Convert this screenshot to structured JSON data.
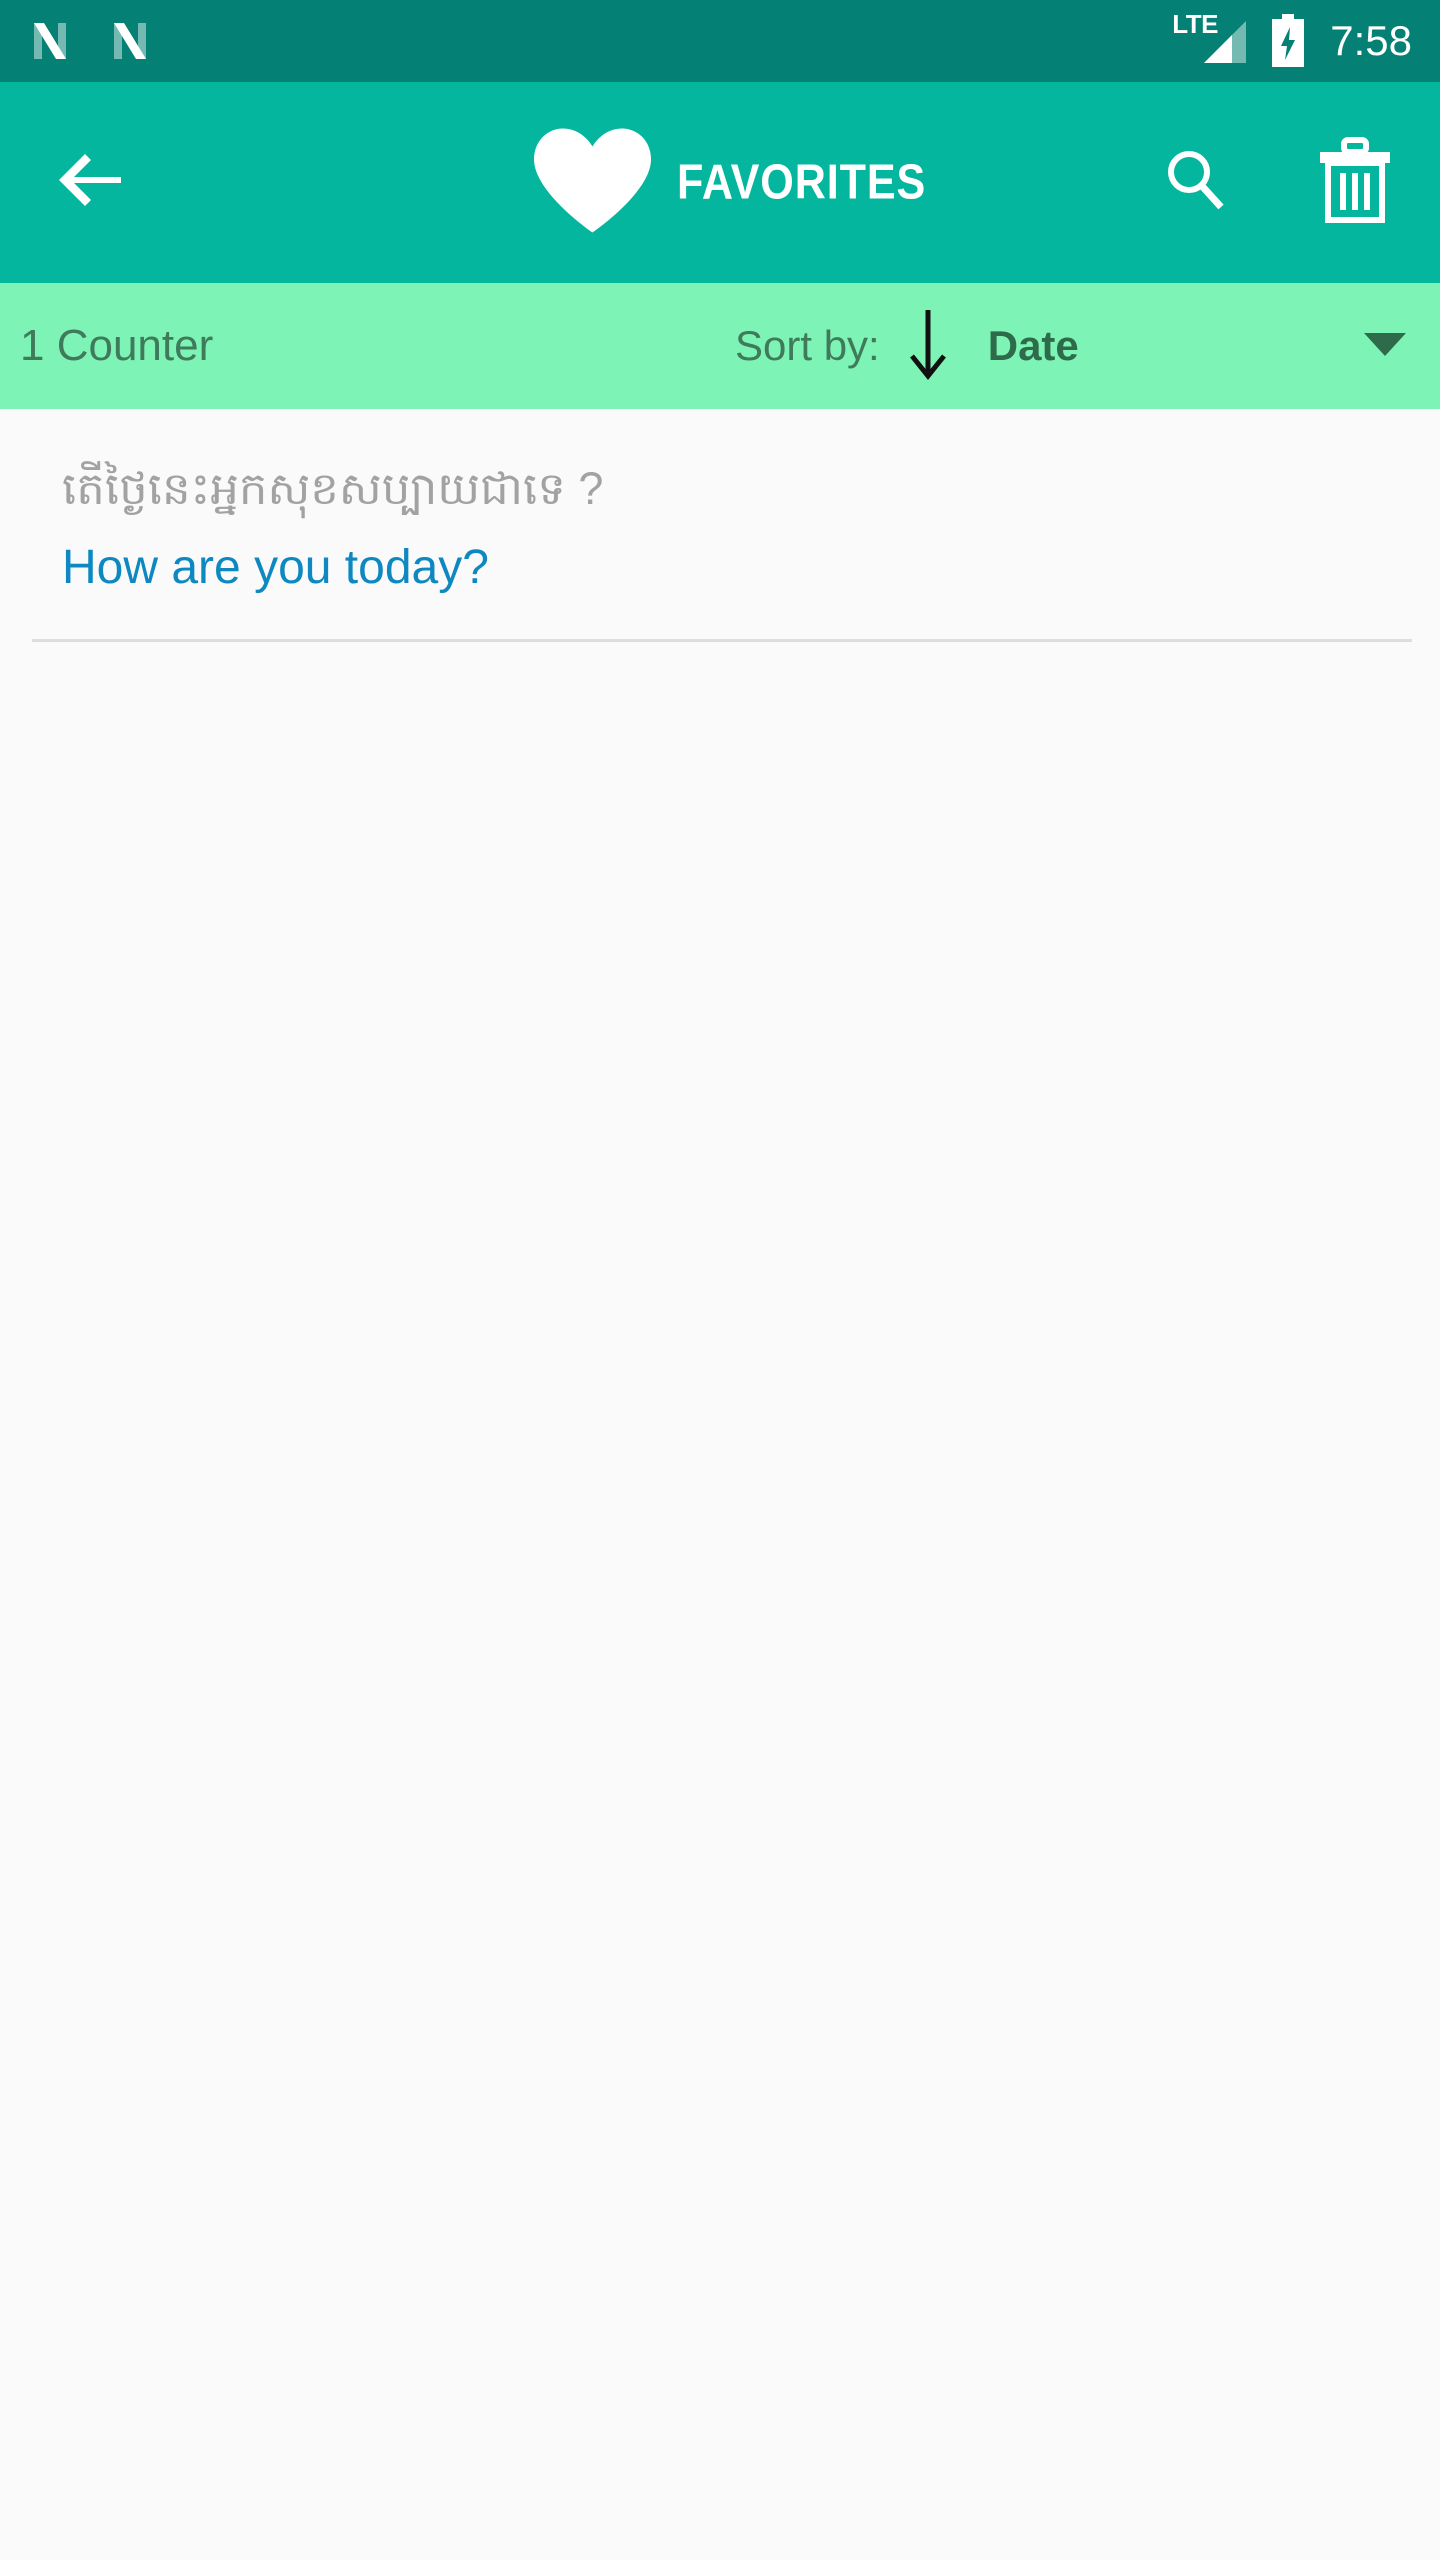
{
  "status_bar": {
    "notification_icons": [
      "n-logo-icon",
      "n-logo-icon"
    ],
    "network_type": "LTE",
    "signal_icon": "signal-bars-icon",
    "battery_icon": "battery-charging-icon",
    "time": "7:58",
    "background_color": "#048174"
  },
  "app_bar": {
    "back_icon": "arrow-left-icon",
    "heart_icon": "heart-icon",
    "title": "FAVORITES",
    "search_icon": "search-icon",
    "delete_icon": "trash-icon",
    "background_color": "#05b69f",
    "foreground_color": "#ffffff"
  },
  "sort_bar": {
    "counter_text": "1 Counter",
    "sort_by_label": "Sort by:",
    "sort_direction_icon": "arrow-down-icon",
    "sort_value": "Date",
    "dropdown_icon": "caret-down-icon",
    "background_color": "#7df4b5",
    "text_color": "#3f7a5b"
  },
  "list": {
    "items": [
      {
        "primary": "តើថ្ងៃនេះអ្នកសុខសប្បាយជាទេ ?",
        "secondary": "How are you today?",
        "primary_color": "#a2a2a2",
        "secondary_color": "#0d88c0"
      }
    ]
  }
}
